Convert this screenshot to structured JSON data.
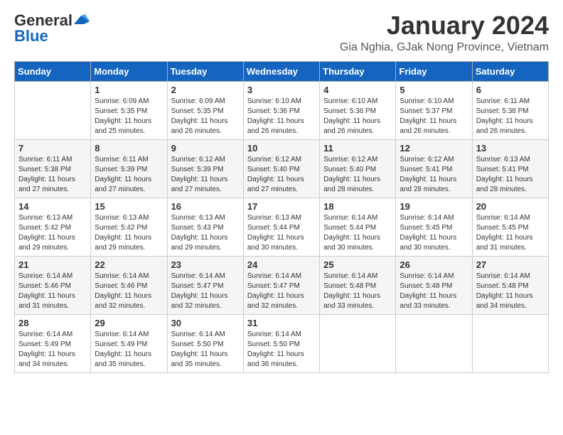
{
  "logo": {
    "general": "General",
    "blue": "Blue"
  },
  "header": {
    "month": "January 2024",
    "location": "Gia Nghia, GJak Nong Province, Vietnam"
  },
  "weekdays": [
    "Sunday",
    "Monday",
    "Tuesday",
    "Wednesday",
    "Thursday",
    "Friday",
    "Saturday"
  ],
  "weeks": [
    [
      {
        "day": "",
        "sunrise": "",
        "sunset": "",
        "daylight": ""
      },
      {
        "day": "1",
        "sunrise": "Sunrise: 6:09 AM",
        "sunset": "Sunset: 5:35 PM",
        "daylight": "Daylight: 11 hours and 25 minutes."
      },
      {
        "day": "2",
        "sunrise": "Sunrise: 6:09 AM",
        "sunset": "Sunset: 5:35 PM",
        "daylight": "Daylight: 11 hours and 26 minutes."
      },
      {
        "day": "3",
        "sunrise": "Sunrise: 6:10 AM",
        "sunset": "Sunset: 5:36 PM",
        "daylight": "Daylight: 11 hours and 26 minutes."
      },
      {
        "day": "4",
        "sunrise": "Sunrise: 6:10 AM",
        "sunset": "Sunset: 5:36 PM",
        "daylight": "Daylight: 11 hours and 26 minutes."
      },
      {
        "day": "5",
        "sunrise": "Sunrise: 6:10 AM",
        "sunset": "Sunset: 5:37 PM",
        "daylight": "Daylight: 11 hours and 26 minutes."
      },
      {
        "day": "6",
        "sunrise": "Sunrise: 6:11 AM",
        "sunset": "Sunset: 5:38 PM",
        "daylight": "Daylight: 11 hours and 26 minutes."
      }
    ],
    [
      {
        "day": "7",
        "sunrise": "Sunrise: 6:11 AM",
        "sunset": "Sunset: 5:38 PM",
        "daylight": "Daylight: 11 hours and 27 minutes."
      },
      {
        "day": "8",
        "sunrise": "Sunrise: 6:11 AM",
        "sunset": "Sunset: 5:39 PM",
        "daylight": "Daylight: 11 hours and 27 minutes."
      },
      {
        "day": "9",
        "sunrise": "Sunrise: 6:12 AM",
        "sunset": "Sunset: 5:39 PM",
        "daylight": "Daylight: 11 hours and 27 minutes."
      },
      {
        "day": "10",
        "sunrise": "Sunrise: 6:12 AM",
        "sunset": "Sunset: 5:40 PM",
        "daylight": "Daylight: 11 hours and 27 minutes."
      },
      {
        "day": "11",
        "sunrise": "Sunrise: 6:12 AM",
        "sunset": "Sunset: 5:40 PM",
        "daylight": "Daylight: 11 hours and 28 minutes."
      },
      {
        "day": "12",
        "sunrise": "Sunrise: 6:12 AM",
        "sunset": "Sunset: 5:41 PM",
        "daylight": "Daylight: 11 hours and 28 minutes."
      },
      {
        "day": "13",
        "sunrise": "Sunrise: 6:13 AM",
        "sunset": "Sunset: 5:41 PM",
        "daylight": "Daylight: 11 hours and 28 minutes."
      }
    ],
    [
      {
        "day": "14",
        "sunrise": "Sunrise: 6:13 AM",
        "sunset": "Sunset: 5:42 PM",
        "daylight": "Daylight: 11 hours and 29 minutes."
      },
      {
        "day": "15",
        "sunrise": "Sunrise: 6:13 AM",
        "sunset": "Sunset: 5:42 PM",
        "daylight": "Daylight: 11 hours and 29 minutes."
      },
      {
        "day": "16",
        "sunrise": "Sunrise: 6:13 AM",
        "sunset": "Sunset: 5:43 PM",
        "daylight": "Daylight: 11 hours and 29 minutes."
      },
      {
        "day": "17",
        "sunrise": "Sunrise: 6:13 AM",
        "sunset": "Sunset: 5:44 PM",
        "daylight": "Daylight: 11 hours and 30 minutes."
      },
      {
        "day": "18",
        "sunrise": "Sunrise: 6:14 AM",
        "sunset": "Sunset: 5:44 PM",
        "daylight": "Daylight: 11 hours and 30 minutes."
      },
      {
        "day": "19",
        "sunrise": "Sunrise: 6:14 AM",
        "sunset": "Sunset: 5:45 PM",
        "daylight": "Daylight: 11 hours and 30 minutes."
      },
      {
        "day": "20",
        "sunrise": "Sunrise: 6:14 AM",
        "sunset": "Sunset: 5:45 PM",
        "daylight": "Daylight: 11 hours and 31 minutes."
      }
    ],
    [
      {
        "day": "21",
        "sunrise": "Sunrise: 6:14 AM",
        "sunset": "Sunset: 5:46 PM",
        "daylight": "Daylight: 11 hours and 31 minutes."
      },
      {
        "day": "22",
        "sunrise": "Sunrise: 6:14 AM",
        "sunset": "Sunset: 5:46 PM",
        "daylight": "Daylight: 11 hours and 32 minutes."
      },
      {
        "day": "23",
        "sunrise": "Sunrise: 6:14 AM",
        "sunset": "Sunset: 5:47 PM",
        "daylight": "Daylight: 11 hours and 32 minutes."
      },
      {
        "day": "24",
        "sunrise": "Sunrise: 6:14 AM",
        "sunset": "Sunset: 5:47 PM",
        "daylight": "Daylight: 11 hours and 32 minutes."
      },
      {
        "day": "25",
        "sunrise": "Sunrise: 6:14 AM",
        "sunset": "Sunset: 5:48 PM",
        "daylight": "Daylight: 11 hours and 33 minutes."
      },
      {
        "day": "26",
        "sunrise": "Sunrise: 6:14 AM",
        "sunset": "Sunset: 5:48 PM",
        "daylight": "Daylight: 11 hours and 33 minutes."
      },
      {
        "day": "27",
        "sunrise": "Sunrise: 6:14 AM",
        "sunset": "Sunset: 5:48 PM",
        "daylight": "Daylight: 11 hours and 34 minutes."
      }
    ],
    [
      {
        "day": "28",
        "sunrise": "Sunrise: 6:14 AM",
        "sunset": "Sunset: 5:49 PM",
        "daylight": "Daylight: 11 hours and 34 minutes."
      },
      {
        "day": "29",
        "sunrise": "Sunrise: 6:14 AM",
        "sunset": "Sunset: 5:49 PM",
        "daylight": "Daylight: 11 hours and 35 minutes."
      },
      {
        "day": "30",
        "sunrise": "Sunrise: 6:14 AM",
        "sunset": "Sunset: 5:50 PM",
        "daylight": "Daylight: 11 hours and 35 minutes."
      },
      {
        "day": "31",
        "sunrise": "Sunrise: 6:14 AM",
        "sunset": "Sunset: 5:50 PM",
        "daylight": "Daylight: 11 hours and 36 minutes."
      },
      {
        "day": "",
        "sunrise": "",
        "sunset": "",
        "daylight": ""
      },
      {
        "day": "",
        "sunrise": "",
        "sunset": "",
        "daylight": ""
      },
      {
        "day": "",
        "sunrise": "",
        "sunset": "",
        "daylight": ""
      }
    ]
  ]
}
